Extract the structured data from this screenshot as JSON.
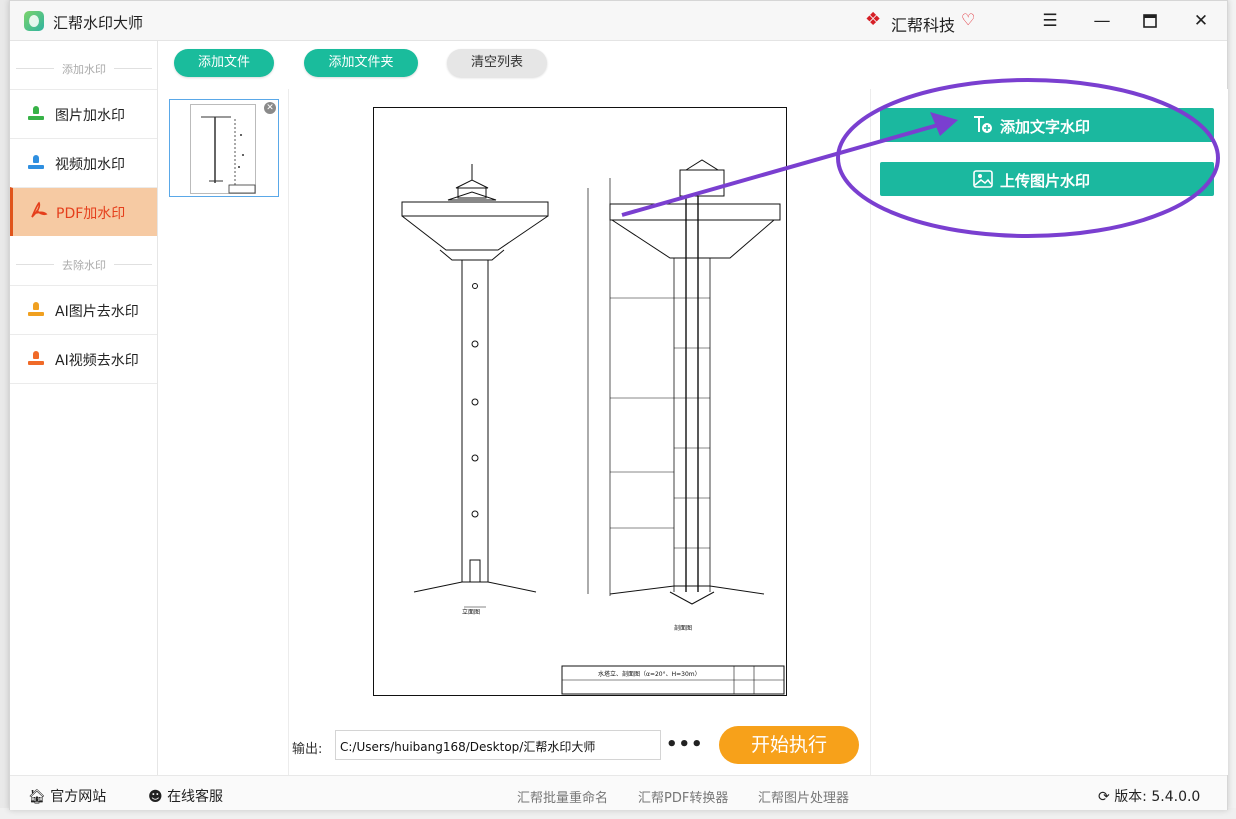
{
  "window": {
    "title": "汇帮水印大师",
    "brand": "汇帮科技",
    "menu_icon": "hamburger-icon",
    "minimize_icon": "minimize-icon",
    "maximize_icon": "maximize-icon",
    "close_icon": "close-icon"
  },
  "sidebar": {
    "section_add": "添加水印",
    "section_remove": "去除水印",
    "items": [
      {
        "label": "图片加水印",
        "icon": "image-stamp-icon"
      },
      {
        "label": "视频加水印",
        "icon": "video-stamp-icon"
      },
      {
        "label": "PDF加水印",
        "icon": "pdf-icon",
        "active": true
      },
      {
        "label": "AI图片去水印",
        "icon": "ai-image-stamp-icon"
      },
      {
        "label": "AI视频去水印",
        "icon": "ai-video-stamp-icon"
      }
    ]
  },
  "toolbar": {
    "add_file": "添加文件",
    "add_folder": "添加文件夹",
    "clear_list": "清空列表"
  },
  "watermark": {
    "add_text": "添加文字水印",
    "upload_image": "上传图片水印"
  },
  "output": {
    "label": "输出:",
    "path": "C:/Users/huibang168/Desktop/汇帮水印大师",
    "more": "•••",
    "start": "开始执行"
  },
  "footer": {
    "website": "官方网站",
    "support": "在线客服",
    "links": [
      "汇帮批量重命名",
      "汇帮PDF转换器",
      "汇帮图片处理器"
    ],
    "version": "版本:  5.4.0.0"
  },
  "colors": {
    "accent": "#1abc9c",
    "start": "#f7a11a",
    "active_bg": "#f6caa3",
    "annotation": "#7a3fd0"
  }
}
